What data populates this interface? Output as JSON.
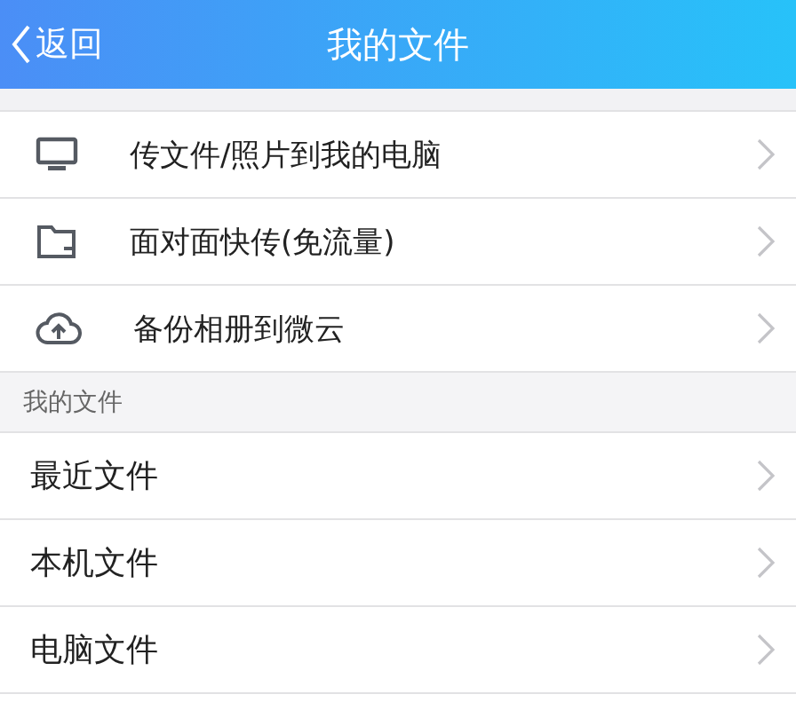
{
  "header": {
    "back": "返回",
    "title": "我的文件"
  },
  "actions": [
    {
      "label": "传文件/照片到我的电脑"
    },
    {
      "label": "面对面快传(免流量)"
    },
    {
      "label": "备份相册到微云"
    }
  ],
  "files_section": {
    "title": "我的文件",
    "items": [
      {
        "label": "最近文件"
      },
      {
        "label": "本机文件"
      },
      {
        "label": "电脑文件"
      }
    ]
  }
}
